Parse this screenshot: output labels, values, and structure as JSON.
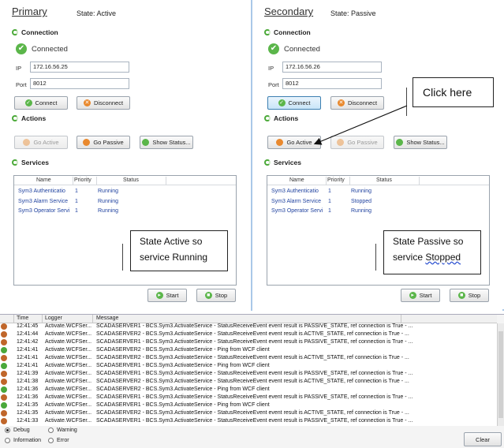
{
  "primary": {
    "title": "Primary",
    "state": "State:   Active",
    "connection_heading": "Connection",
    "connected_text": "Connected",
    "ip_label": "IP",
    "ip_value": "172.16.56.25",
    "port_label": "Port",
    "port_value": "8012",
    "connect_label": "Connect",
    "disconnect_label": "Disconnect",
    "actions_heading": "Actions",
    "go_active_label": "Go Active",
    "go_passive_label": "Go Passive",
    "show_status_label": "Show Status...",
    "services_heading": "Services",
    "columns": [
      "Name",
      "Priority",
      "Status"
    ],
    "services": [
      {
        "name": "Sym3 Authenticatio",
        "priority": "1",
        "status": "Running"
      },
      {
        "name": "Sym3 Alarm Service",
        "priority": "1",
        "status": "Running"
      },
      {
        "name": "Sym3 Operator Servi",
        "priority": "1",
        "status": "Running"
      }
    ],
    "start_label": "Start",
    "stop_label": "Stop"
  },
  "secondary": {
    "title": "Secondary",
    "state": "State:   Passive",
    "connection_heading": "Connection",
    "connected_text": "Connected",
    "ip_label": "IP",
    "ip_value": "172.16.56.26",
    "port_label": "Port",
    "port_value": "8012",
    "connect_label": "Connect",
    "disconnect_label": "Disconnect",
    "actions_heading": "Actions",
    "go_active_label": "Go Active",
    "go_passive_label": "Go Passive",
    "show_status_label": "Show Status...",
    "services_heading": "Services",
    "columns": [
      "Name",
      "Priority",
      "Status"
    ],
    "services": [
      {
        "name": "Sym3 Authenticatio",
        "priority": "1",
        "status": "Running"
      },
      {
        "name": "Sym3 Alarm Service",
        "priority": "1",
        "status": "Stopped"
      },
      {
        "name": "Sym3 Operator Servi",
        "priority": "1",
        "status": "Running"
      }
    ],
    "start_label": "Start",
    "stop_label": "Stop"
  },
  "callouts": {
    "click_here": "Click here",
    "active_line1": "State Active so",
    "active_line2": "service Running",
    "passive_line1": "State Passive so",
    "passive_line2_pre": "service ",
    "passive_line2_word": "Stopped"
  },
  "log": {
    "columns": [
      "Time",
      "Logger",
      "Message"
    ],
    "rows": [
      {
        "level": "debug",
        "time": "12:41:45",
        "logger": "Activate.WCFSer...",
        "message": "SCADASERVER1 - BCS.Sym3.ActivateService - StatusReceiveEvent event result is PASSIVE_STATE, ref connection is True - ..."
      },
      {
        "level": "debug",
        "time": "12:41:44",
        "logger": "Activate.WCFSer...",
        "message": "SCADASERVER2 - BCS.Sym3.ActivateService - StatusReceiveEvent event result is ACTIVE_STATE, ref connection is True - ..."
      },
      {
        "level": "debug",
        "time": "12:41:42",
        "logger": "Activate.WCFSer...",
        "message": "SCADASERVER1 - BCS.Sym3.ActivateService - StatusReceiveEvent event result is PASSIVE_STATE, ref connection is True - ..."
      },
      {
        "level": "info",
        "time": "12:41:41",
        "logger": "Activate.WCFSer...",
        "message": "SCADASERVER2 - BCS.Sym3.ActivateService - Ping from WCF client"
      },
      {
        "level": "debug",
        "time": "12:41:41",
        "logger": "Activate.WCFSer...",
        "message": "SCADASERVER2 - BCS.Sym3.ActivateService - StatusReceiveEvent event result is ACTIVE_STATE, ref connection is True - ..."
      },
      {
        "level": "info",
        "time": "12:41:41",
        "logger": "Activate.WCFSer...",
        "message": "SCADASERVER1 - BCS.Sym3.ActivateService - Ping from WCF client"
      },
      {
        "level": "debug",
        "time": "12:41:39",
        "logger": "Activate.WCFSer...",
        "message": "SCADASERVER1 - BCS.Sym3.ActivateService - StatusReceiveEvent event result is PASSIVE_STATE, ref connection is True - ..."
      },
      {
        "level": "debug",
        "time": "12:41:38",
        "logger": "Activate.WCFSer...",
        "message": "SCADASERVER2 - BCS.Sym3.ActivateService - StatusReceiveEvent event result is ACTIVE_STATE, ref connection is True - ..."
      },
      {
        "level": "info",
        "time": "12:41:36",
        "logger": "Activate.WCFSer...",
        "message": "SCADASERVER2 - BCS.Sym3.ActivateService - Ping from WCF client"
      },
      {
        "level": "debug",
        "time": "12:41:36",
        "logger": "Activate.WCFSer...",
        "message": "SCADASERVER1 - BCS.Sym3.ActivateService - StatusReceiveEvent event result is PASSIVE_STATE, ref connection is True - ..."
      },
      {
        "level": "info",
        "time": "12:41:35",
        "logger": "Activate.WCFSer...",
        "message": "SCADASERVER1 - BCS.Sym3.ActivateService - Ping from WCF client"
      },
      {
        "level": "debug",
        "time": "12:41:35",
        "logger": "Activate.WCFSer...",
        "message": "SCADASERVER2 - BCS.Sym3.ActivateService - StatusReceiveEvent event result is ACTIVE_STATE, ref connection is True - ..."
      },
      {
        "level": "debug",
        "time": "12:41:33",
        "logger": "Activate.WCFSer...",
        "message": "SCADASERVER1 - BCS.Sym3.ActivateService - StatusReceiveEvent event result is PASSIVE_STATE, ref connection is True - ..."
      }
    ],
    "filters": {
      "debug": "Debug",
      "warning": "Warning",
      "information": "Information",
      "error": "Error"
    },
    "clear_label": "Clear"
  }
}
